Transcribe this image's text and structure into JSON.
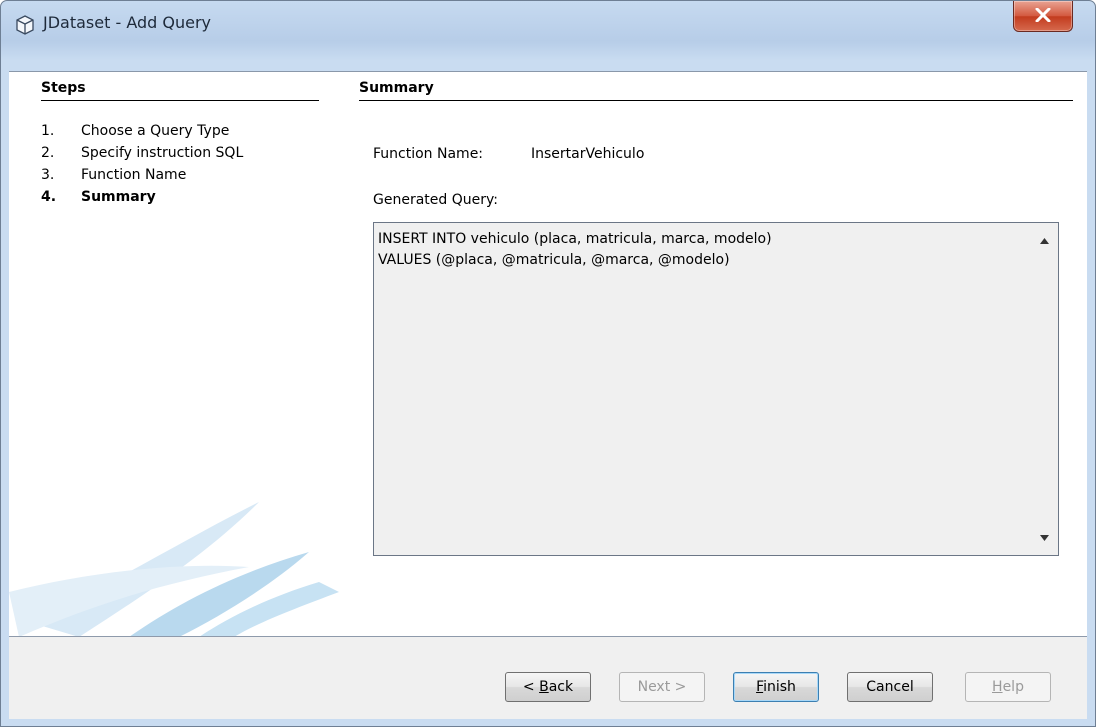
{
  "window": {
    "title": "JDataset - Add Query",
    "close_icon": "close-icon"
  },
  "steps": {
    "title": "Steps",
    "items": [
      {
        "number": "1.",
        "label": "Choose a Query Type",
        "current": false
      },
      {
        "number": "2.",
        "label": "Specify instruction SQL",
        "current": false
      },
      {
        "number": "3.",
        "label": "Function Name",
        "current": false
      },
      {
        "number": "4.",
        "label": "Summary",
        "current": true
      }
    ]
  },
  "summary": {
    "title": "Summary",
    "function_name_label": "Function Name:",
    "function_name_value": "InsertarVehiculo",
    "generated_query_label": "Generated Query:",
    "query_lines": [
      "INSERT INTO vehiculo (placa, matricula, marca, modelo)",
      "VALUES (@placa, @matricula, @marca, @modelo)"
    ]
  },
  "buttons": {
    "back": {
      "pre": "< ",
      "mnemonic": "B",
      "post": "ack",
      "enabled": true
    },
    "next": {
      "label": "Next >",
      "enabled": false
    },
    "finish": {
      "pre": "",
      "mnemonic": "F",
      "post": "inish",
      "enabled": true,
      "default": true
    },
    "cancel": {
      "label": "Cancel",
      "enabled": true
    },
    "help": {
      "pre": "",
      "mnemonic": "H",
      "post": "elp",
      "enabled": false
    }
  },
  "colors": {
    "title_bar": "#c6daf0",
    "close_button": "#c23b1e",
    "panel_background": "#f0f0f0"
  }
}
